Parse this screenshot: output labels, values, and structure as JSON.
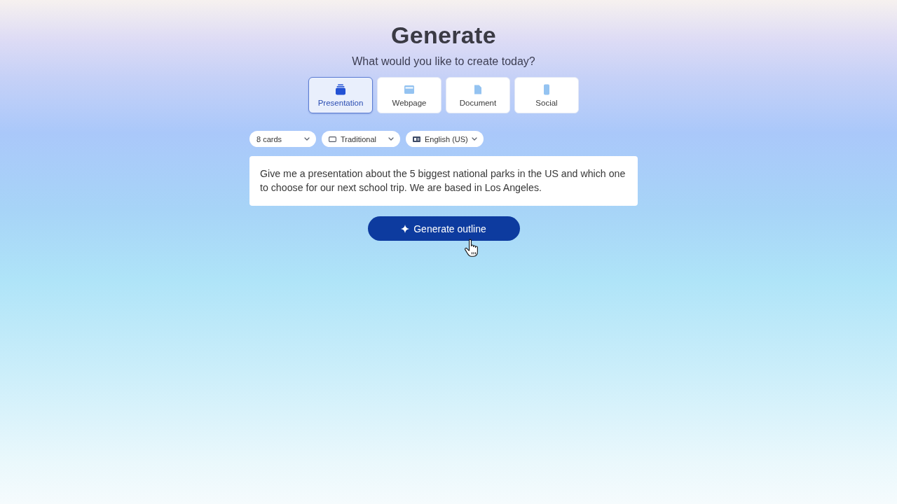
{
  "heading": "Generate",
  "subheading": "What would you like to create today?",
  "content_types": [
    {
      "label": "Presentation",
      "kind": "presentation",
      "selected": true
    },
    {
      "label": "Webpage",
      "kind": "webpage",
      "selected": false
    },
    {
      "label": "Document",
      "kind": "document",
      "selected": false
    },
    {
      "label": "Social",
      "kind": "social",
      "selected": false
    }
  ],
  "settings": [
    {
      "label": "8 cards",
      "kind": "count"
    },
    {
      "label": "Traditional",
      "kind": "format"
    },
    {
      "label": "English (US)",
      "kind": "language"
    }
  ],
  "prompt": {
    "value": "Give me a presentation about the 5 biggest national parks in the US and which one to choose for our next school trip. We are based in Los Angeles."
  },
  "generate_button": {
    "label": "Generate outline"
  }
}
